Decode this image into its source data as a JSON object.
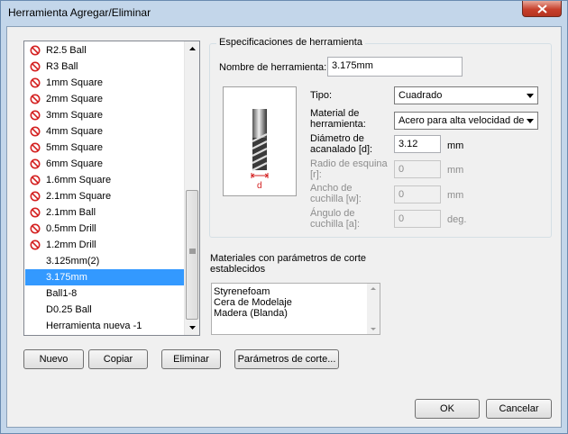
{
  "window": {
    "title": "Herramienta Agregar/Eliminar"
  },
  "tool_list": {
    "items": [
      {
        "label": "R2.5 Ball",
        "prohibited": true
      },
      {
        "label": "R3 Ball",
        "prohibited": true
      },
      {
        "label": "1mm Square",
        "prohibited": true
      },
      {
        "label": "2mm Square",
        "prohibited": true
      },
      {
        "label": "3mm Square",
        "prohibited": true
      },
      {
        "label": "4mm Square",
        "prohibited": true
      },
      {
        "label": "5mm Square",
        "prohibited": true
      },
      {
        "label": "6mm Square",
        "prohibited": true
      },
      {
        "label": "1.6mm Square",
        "prohibited": true
      },
      {
        "label": "2.1mm Square",
        "prohibited": true
      },
      {
        "label": "2.1mm Ball",
        "prohibited": true
      },
      {
        "label": "0.5mm Drill",
        "prohibited": true
      },
      {
        "label": "1.2mm Drill",
        "prohibited": true
      },
      {
        "label": "3.125mm(2)",
        "prohibited": false
      },
      {
        "label": "3.175mm",
        "prohibited": false,
        "selected": true
      },
      {
        "label": "Ball1-8",
        "prohibited": false
      },
      {
        "label": "D0.25 Ball",
        "prohibited": false
      },
      {
        "label": "Herramienta nueva -1",
        "prohibited": false
      }
    ]
  },
  "buttons": {
    "new": "Nuevo",
    "copy": "Copiar",
    "delete": "Eliminar",
    "cutting_params": "Parámetros de corte...",
    "ok": "OK",
    "cancel": "Cancelar"
  },
  "spec": {
    "group_title": "Especificaciones de herramienta",
    "name_label": "Nombre de herramienta:",
    "name_value": "3.175mm",
    "type_label": "Tipo:",
    "type_value": "Cuadrado",
    "material_label_1": "Material de",
    "material_label_2": "herramienta:",
    "material_value": "Acero para alta velocidad de",
    "diameter_label_1": "Diámetro de",
    "diameter_label_2": "acanalado [d]:",
    "diameter_value": "3.12",
    "diameter_unit": "mm",
    "corner_label_1": "Radio de esquina",
    "corner_label_2": "[r]:",
    "corner_value": "0",
    "corner_unit": "mm",
    "width_label_1": "Ancho de",
    "width_label_2": "cuchilla [w]:",
    "width_value": "0",
    "width_unit": "mm",
    "angle_label_1": "Ángulo de",
    "angle_label_2": "cuchilla [a]:",
    "angle_value": "0",
    "angle_unit": "deg.",
    "diagram_label": "d"
  },
  "materials": {
    "heading_1": "Materiales con parámetros de corte",
    "heading_2": "establecidos",
    "items": [
      "Styrenefoam",
      "Cera de Modelaje",
      "Madera (Blanda)"
    ]
  },
  "colors": {
    "selection": "#3399ff",
    "prohibited": "#d42020",
    "close": "#c7402c"
  }
}
